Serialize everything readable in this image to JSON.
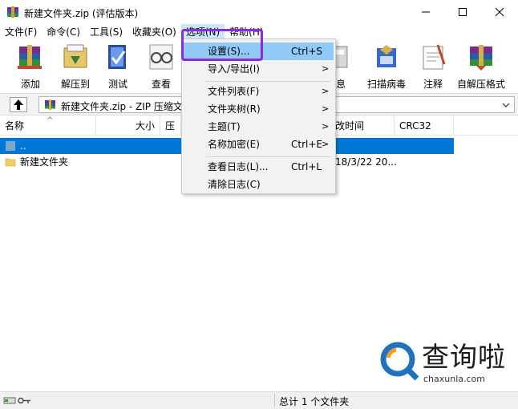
{
  "window": {
    "title": "新建文件夹.zip (评估版本)"
  },
  "menubar": {
    "items": [
      "文件(F)",
      "命令(C)",
      "工具(S)",
      "收藏夹(O)",
      "选项(N)",
      "帮助(H)"
    ]
  },
  "toolbar": {
    "add": "添加",
    "extract_to": "解压到",
    "test": "测试",
    "view": "查看",
    "info": "息",
    "scan_virus": "扫描病毒",
    "comment": "注释",
    "sfx": "自解压格式"
  },
  "address": {
    "path": "新建文件夹.zip - ZIP 压缩文"
  },
  "columns": {
    "name": "名称",
    "size": "大小",
    "packed": "压",
    "modified": "改时间",
    "crc": "CRC32"
  },
  "files": [
    {
      "name": "..",
      "time": ""
    },
    {
      "name": "新建文件夹",
      "time": "18/3/22 20..."
    }
  ],
  "status": {
    "summary": "总计 1 个文件夹"
  },
  "options_menu": {
    "settings": "设置(S)...",
    "settings_shortcut": "Ctrl+S",
    "import_export": "导入/导出(I)",
    "file_list": "文件列表(F)",
    "folder_tree": "文件夹树(R)",
    "theme": "主题(T)",
    "name_encryption": "名称加密(E)",
    "name_encryption_shortcut": "Ctrl+E",
    "view_log": "查看日志(L)...",
    "view_log_shortcut": "Ctrl+L",
    "clear_log": "清除日志(C)",
    "arrow": ">"
  },
  "watermark": {
    "text": "查询啦",
    "url": "chaxunla.com"
  },
  "colors": {
    "selection": "#0078d7",
    "menu_highlight": "#91c9f7",
    "highlight_box": "#8a2be2"
  }
}
